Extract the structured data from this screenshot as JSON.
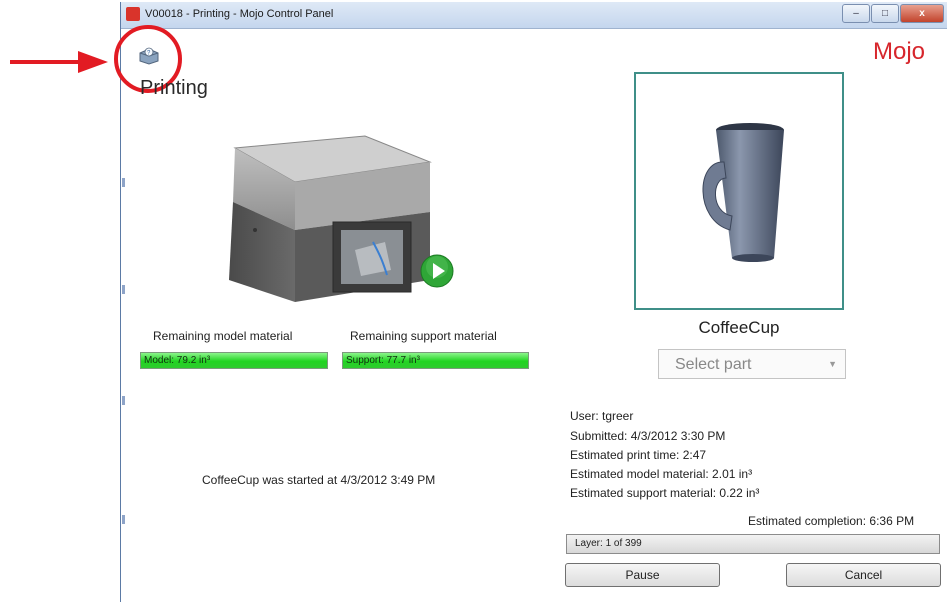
{
  "window": {
    "title": "V00018 - Printing - Mojo Control Panel",
    "controls": {
      "minimize": "–",
      "maximize": "□",
      "close": "x"
    }
  },
  "header": {
    "logo": "Mojo",
    "page_title": "Printing"
  },
  "materials": {
    "model_label": "Remaining model material",
    "model_bar": "Model: 79.2 in³",
    "support_label": "Remaining support material",
    "support_bar": "Support: 77.7 in³",
    "colors": {
      "bar_green": "#21d421"
    }
  },
  "status_text": "CoffeeCup was started at 4/3/2012 3:49 PM",
  "part": {
    "name": "CoffeeCup",
    "select_placeholder": "Select part"
  },
  "job": {
    "user": "User: tgreer",
    "submitted": "Submitted: 4/3/2012 3:30 PM",
    "print_time": "Estimated print time: 2:47",
    "model_material": "Estimated model material: 2.01 in³",
    "support_material": "Estimated support material: 0.22 in³",
    "completion": "Estimated completion:  6:36 PM"
  },
  "progress": {
    "layer_text": "Layer: 1 of 399",
    "fraction": 0.0025
  },
  "buttons": {
    "pause": "Pause",
    "cancel": "Cancel"
  },
  "icons": {
    "help": "printer-help-icon",
    "play": "play-icon"
  }
}
